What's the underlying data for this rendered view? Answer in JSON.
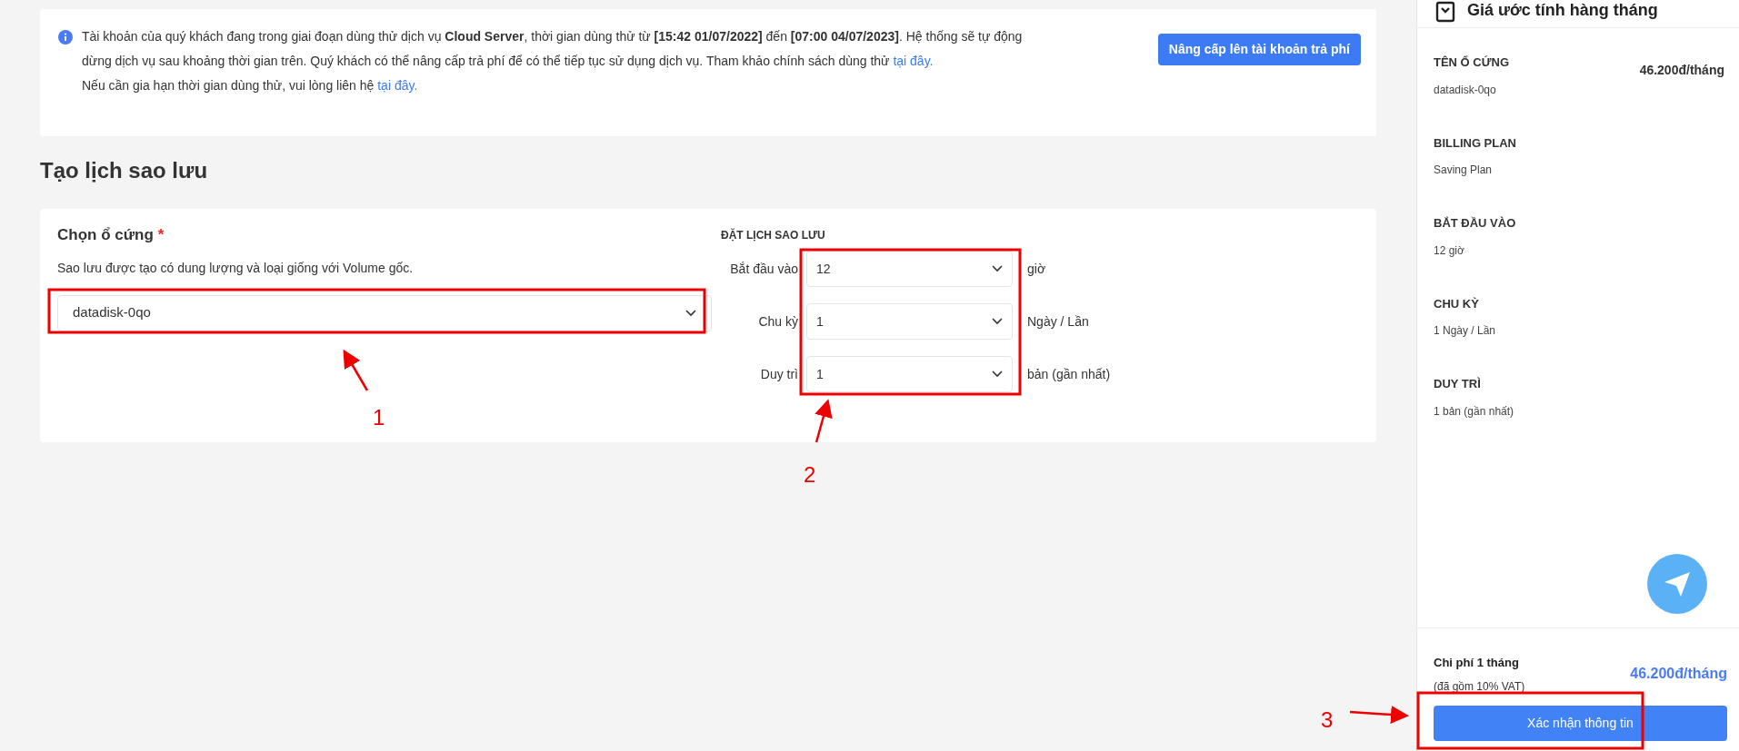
{
  "notice": {
    "text": "Tài khoản của quý khách đang trong giai đoạn dùng thử dịch vụ **Cloud Server**, thời gian dùng thử từ **[15:42 01/07/2022]** đến **[07:00 04/07/2023]**. Hệ thống sẽ tự động dừng dịch vụ sau khoảng thời gian trên. Quý khách có thể nâng cấp trả phí để có thể tiếp tục sử dụng dịch vụ. Tham khảo chính sách dùng thử ",
    "link": "tại đây.",
    "text_2": "Nếu cần gia hạn thời gian dùng thử, vui lòng liên hệ ",
    "link_2": "tại đây.",
    "button": "Nâng cấp lên tài khoản trả phí"
  },
  "page_title": "Tạo lịch sao lưu",
  "disk": {
    "label": "Chọn ổ cứng",
    "required_mark": "*",
    "description": "Sao lưu được tạo có dung lượng và loại giống với Volume gốc.",
    "value": "datadisk-0qo"
  },
  "schedule": {
    "title": "ĐẶT LỊCH SAO LƯU",
    "rows": [
      {
        "label": "Bắt đầu vào",
        "value": "12",
        "unit": "giờ"
      },
      {
        "label": "Chu kỳ",
        "value": "1",
        "unit": "Ngày / Lần"
      },
      {
        "label": "Duy trì",
        "value": "1",
        "unit": "bản (gần nhất)"
      }
    ]
  },
  "summary": {
    "title": "Giá ước tính hàng tháng",
    "items": [
      {
        "label": "TÊN Ổ CỨNG",
        "value": "datadisk-0qo",
        "price": "46.200đ/tháng"
      },
      {
        "label": "BILLING PLAN",
        "value": "Saving Plan"
      },
      {
        "label": "BẮT ĐẦU VÀO",
        "value": "12 giờ"
      },
      {
        "label": "CHU KỲ",
        "value": "1 Ngày / Lần"
      },
      {
        "label": "DUY TRÌ",
        "value": "1 bản (gần nhất)"
      }
    ],
    "total_label": "Chi phí 1 tháng",
    "total_note": "(đã gồm 10% VAT)",
    "total_price": "46.200đ/tháng",
    "confirm_button": "Xác nhận thông tin"
  },
  "annotations": [
    {
      "number": "1"
    },
    {
      "number": "2"
    },
    {
      "number": "3"
    }
  ]
}
